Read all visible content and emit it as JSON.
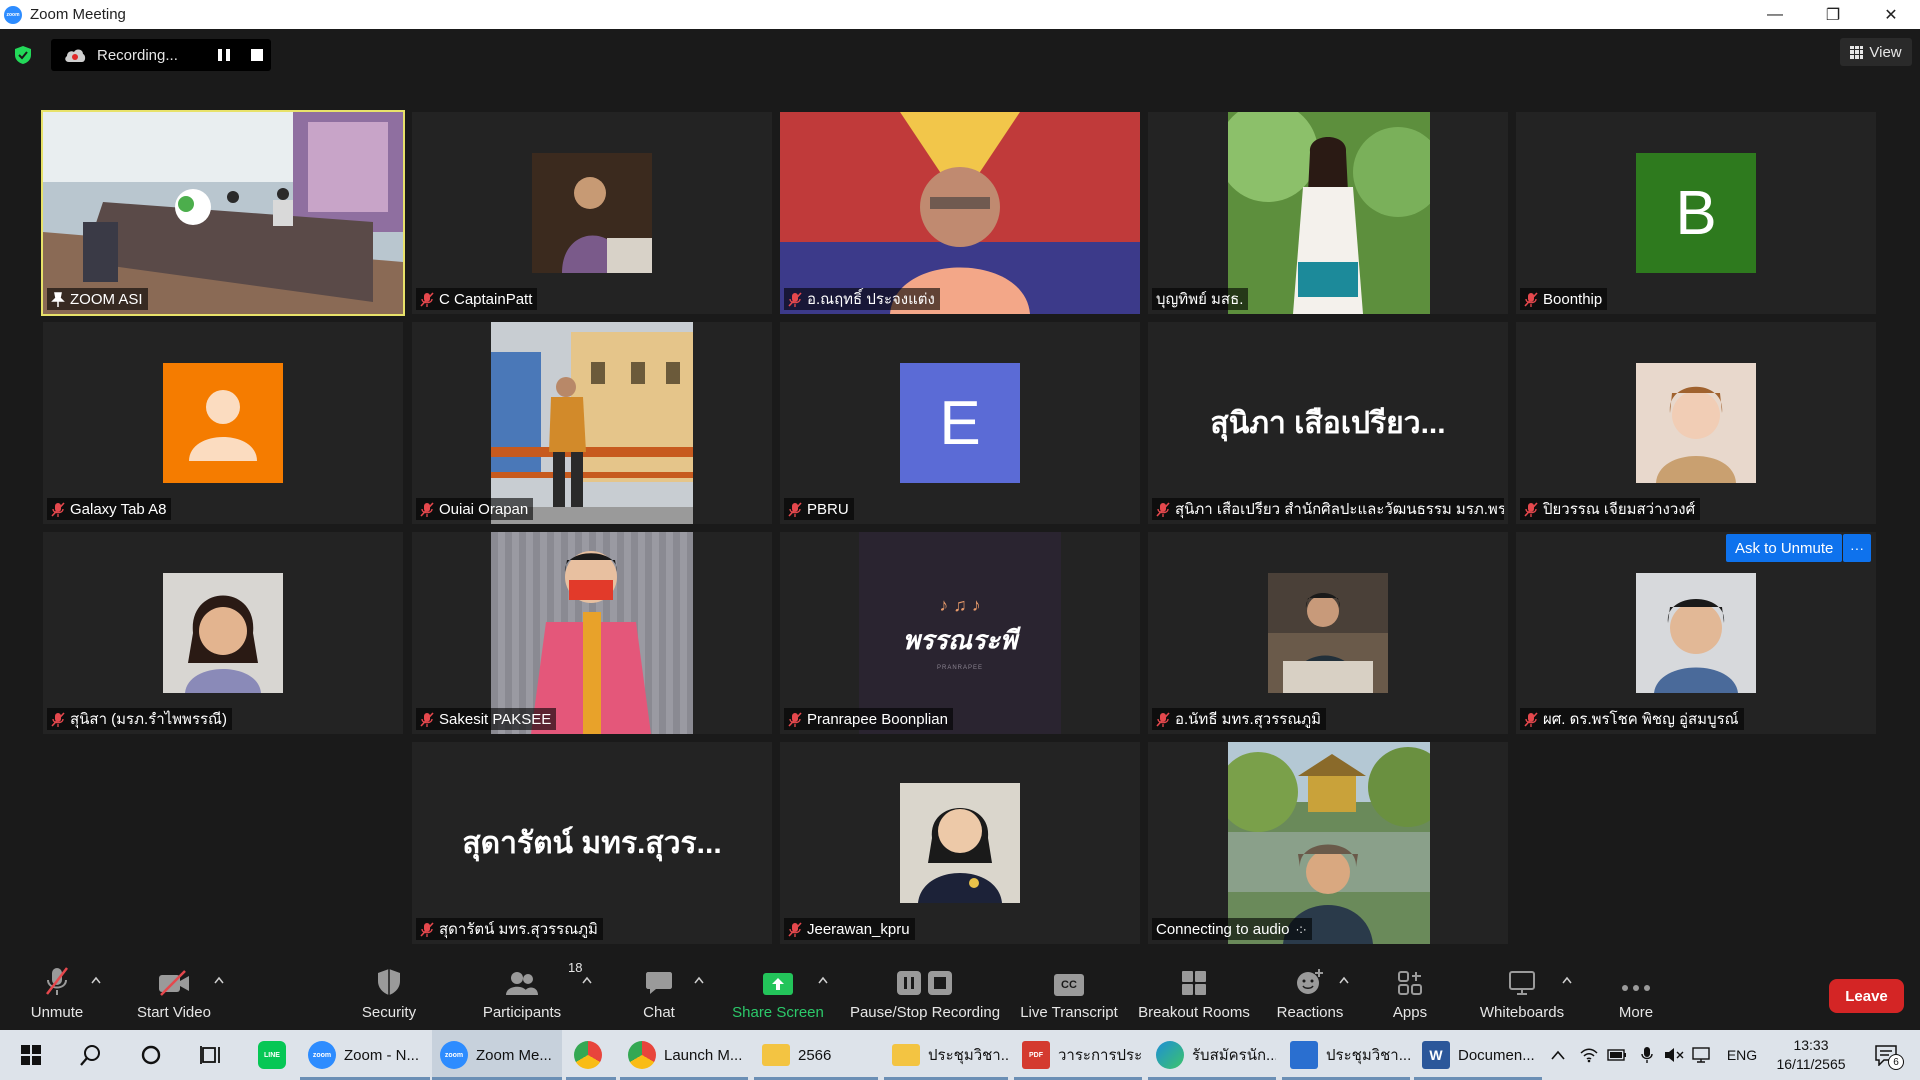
{
  "window": {
    "title": "Zoom Meeting",
    "minimize": "—",
    "restore": "❐",
    "close": "✕",
    "logo": "zoom"
  },
  "topbar": {
    "recording_label": "Recording...",
    "view_label": "View"
  },
  "tiles": [
    {
      "name": "ZOOM ASI"
    },
    {
      "name": "C CaptainPatt"
    },
    {
      "name": "อ.ณฤทธิ์ ประจงแต่ง"
    },
    {
      "name": "บุญทิพย์ มสธ."
    },
    {
      "name": "Boonthip",
      "avatar_letter": "B",
      "avatar_color": "#2e7a1e"
    },
    {
      "name": "Galaxy Tab A8",
      "avatar_color": "#f57c00"
    },
    {
      "name": "Ouiai Orapan"
    },
    {
      "name": "PBRU",
      "avatar_letter": "E",
      "avatar_color": "#5b6bd6"
    },
    {
      "name": "สุนิภา เสือเปรียว สำนักศิลปะและวัฒนธรรม มรภ.พระน...",
      "display_name": "สุนิภา เสือเปรียว..."
    },
    {
      "name": "ปิยวรรณ เจียมสว่างวงศ์"
    },
    {
      "name": "สุนิสา (มรภ.รำไพพรรณี)"
    },
    {
      "name": "Sakesit PAKSEE"
    },
    {
      "name": "Pranrapee Boonplian",
      "logo_text": "พรรณระพี",
      "logo_notes": "♪ ♫ ♪",
      "logo_sub": "PRANRAPEE"
    },
    {
      "name": "อ.นัทธี มทร.สุวรรณภูมิ"
    },
    {
      "name": "ผศ. ดร.พรโชค พิชญ อู่สมบูรณ์"
    },
    {
      "name": "สุดารัตน์ มทร.สุวรรณภูมิ",
      "display_name": "สุดารัตน์ มทร.สุวร..."
    },
    {
      "name": "Jeerawan_kpru"
    },
    {
      "name": "Connecting to audio"
    }
  ],
  "ask_unmute": {
    "label": "Ask to Unmute",
    "more": "···"
  },
  "toolbar": {
    "unmute": "Unmute",
    "start_video": "Start Video",
    "security": "Security",
    "participants": "Participants",
    "participants_count": "18",
    "chat": "Chat",
    "share_screen": "Share Screen",
    "pause_stop": "Pause/Stop Recording",
    "live_transcript": "Live Transcript",
    "cc": "CC",
    "breakout": "Breakout Rooms",
    "reactions": "Reactions",
    "apps": "Apps",
    "whiteboards": "Whiteboards",
    "more": "More",
    "leave": "Leave"
  },
  "taskbar": {
    "apps": [
      {
        "label": "",
        "color": "#06c755",
        "icon_text": "LINE"
      },
      {
        "label": "Zoom - N...",
        "color": "#2d8cff",
        "icon_text": "zoom"
      },
      {
        "label": "Zoom Me...",
        "color": "#2d8cff",
        "icon_text": "zoom"
      },
      {
        "label": "",
        "color": "#e8453c",
        "icon_text": ""
      },
      {
        "label": "Launch M...",
        "color": "#e8453c",
        "icon_text": ""
      },
      {
        "label": "2566",
        "color": "#f3c442",
        "icon_text": ""
      },
      {
        "label": "ประชุมวิชา...",
        "color": "#f3c442",
        "icon_text": ""
      },
      {
        "label": "วาระการประ...",
        "color": "#d43a2f",
        "icon_text": "PDF"
      },
      {
        "label": "รับสมัครนัก...",
        "color": "#1e8fd6",
        "icon_text": ""
      },
      {
        "label": "ประชุมวิชา...",
        "color": "#2a6fd0",
        "icon_text": ""
      },
      {
        "label": "Documen...",
        "color": "#2b579a",
        "icon_text": "W"
      }
    ],
    "lang": "ENG",
    "time": "13:33",
    "date": "16/11/2565",
    "notif_count": "6"
  }
}
